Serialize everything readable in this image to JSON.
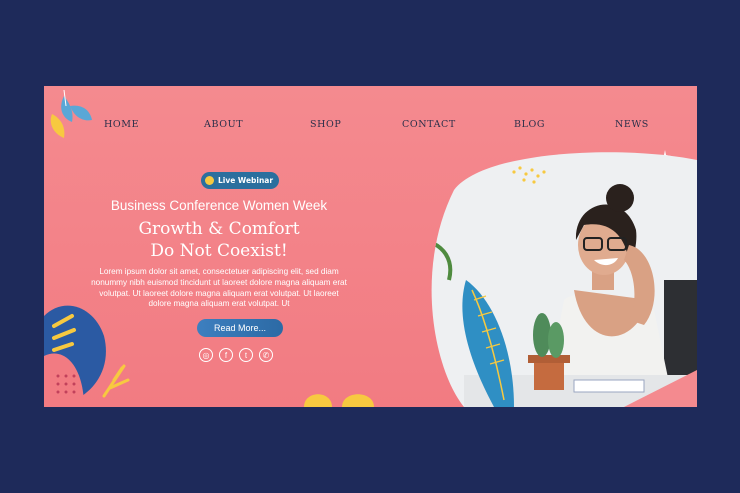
{
  "nav": {
    "items": [
      {
        "label": "HOME"
      },
      {
        "label": "ABOUT"
      },
      {
        "label": "SHOP"
      },
      {
        "label": "CONTACT"
      },
      {
        "label": "BLOG"
      },
      {
        "label": "NEWS"
      }
    ]
  },
  "hero": {
    "badge_label": "Live Webinar",
    "subtitle": "Business Conference Women Week",
    "headline_line1": "Growth & Comfort",
    "headline_line2": "Do Not Coexist!",
    "body": "Lorem ipsum dolor sit amet, consectetuer adipiscing elit, sed diam nonummy nibh euismod tincidunt ut laoreet dolore magna aliquam erat volutpat. Ut  laoreet dolore magna aliquam erat volutpat. Ut  laoreet dolore magna aliquam erat volutpat. Ut",
    "cta_label": "Read More..."
  },
  "socials": [
    {
      "icon": "instagram-icon",
      "glyph": "◎"
    },
    {
      "icon": "facebook-icon",
      "glyph": "f"
    },
    {
      "icon": "twitter-icon",
      "glyph": "t"
    },
    {
      "icon": "whatsapp-icon",
      "glyph": "✆"
    }
  ],
  "colors": {
    "page_bg": "#1e2a5a",
    "banner_pink": "#f48a8f",
    "button_blue": "#2c6aa5",
    "accent_yellow": "#f7c940",
    "nav_text": "#2b2f4a"
  }
}
